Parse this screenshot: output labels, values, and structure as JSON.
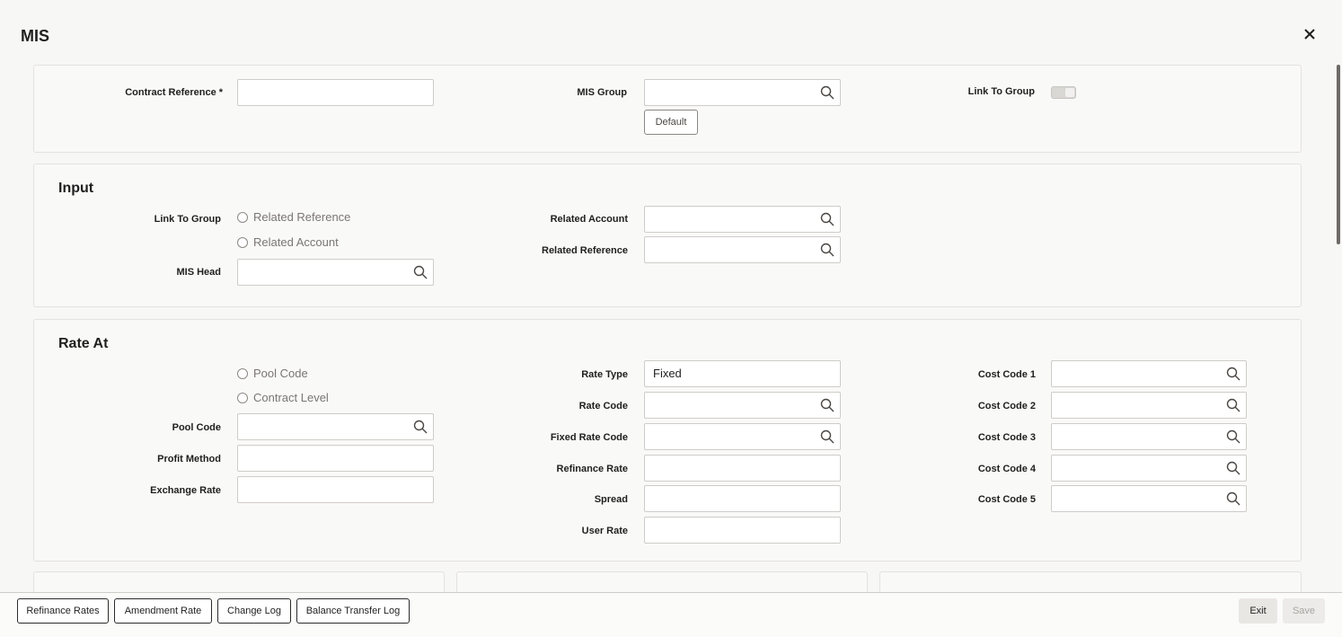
{
  "window": {
    "title": "MIS",
    "close_icon": "close-icon"
  },
  "header_panel": {
    "contract_reference_label": "Contract Reference",
    "contract_reference_required": "*",
    "contract_reference_value": "",
    "mis_group_label": "MIS Group",
    "mis_group_value": "",
    "default_button": "Default",
    "link_to_group_label": "Link To Group",
    "link_to_group_on": false
  },
  "input_section": {
    "title": "Input",
    "link_to_group_label": "Link To Group",
    "radio_related_reference": "Related Reference",
    "radio_related_account": "Related Account",
    "mis_head_label": "MIS Head",
    "mis_head_value": "",
    "related_account_label": "Related Account",
    "related_account_value": "",
    "related_reference_label": "Related Reference",
    "related_reference_value": ""
  },
  "rate_at_section": {
    "title": "Rate At",
    "radio_pool_code": "Pool Code",
    "radio_contract_level": "Contract Level",
    "pool_code_label": "Pool Code",
    "profit_method_label": "Profit Method",
    "exchange_rate_label": "Exchange Rate",
    "rate_type_label": "Rate Type",
    "rate_type_value": "Fixed",
    "rate_code_label": "Rate Code",
    "fixed_rate_code_label": "Fixed Rate Code",
    "refinance_rate_label": "Refinance Rate",
    "spread_label": "Spread",
    "user_rate_label": "User Rate",
    "cost_code_1_label": "Cost Code 1",
    "cost_code_2_label": "Cost Code 2",
    "cost_code_3_label": "Cost Code 3",
    "cost_code_4_label": "Cost Code 4",
    "cost_code_5_label": "Cost Code 5"
  },
  "footer": {
    "refinance_rates": "Refinance Rates",
    "amendment_rate": "Amendment Rate",
    "change_log": "Change Log",
    "balance_transfer_log": "Balance Transfer Log",
    "exit": "Exit",
    "save": "Save"
  },
  "colors": {
    "panel_border": "#e4e2df",
    "field_border": "#cfccc8",
    "label": "#1f1f1f",
    "radio_text": "#7a7672"
  }
}
